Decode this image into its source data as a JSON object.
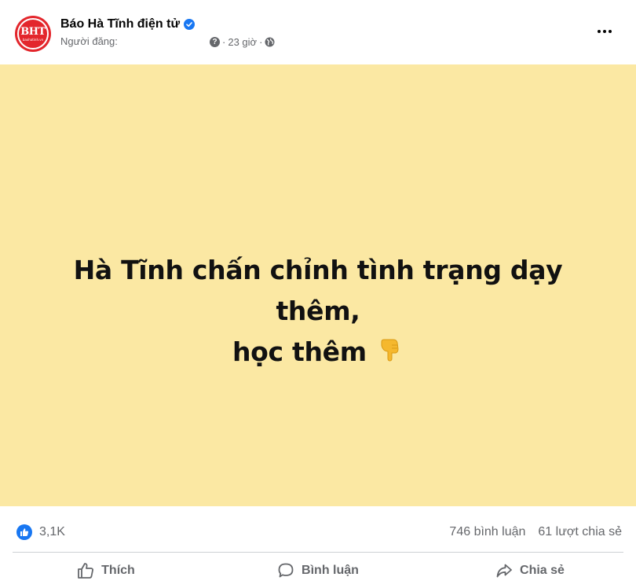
{
  "post": {
    "page_name": "Báo Hà Tĩnh điện tử",
    "avatar_text": "BHT",
    "avatar_subtext": "baohatinh.vn",
    "poster_label": "Người đăng:",
    "time": "23 giờ",
    "meta_separator": "·",
    "help_icon_glyph": "?",
    "icons": {
      "verified": "verified-badge-icon",
      "help": "question-icon",
      "privacy": "globe-icon",
      "more": "more-options-icon",
      "emoji": "backhand-index-pointing-down-icon"
    },
    "content_lines": [
      "Hà Tĩnh chấn chỉnh tình trạng dạy thêm,",
      "học thêm"
    ],
    "background_color": "#fbe8a3"
  },
  "stats": {
    "reaction_count": "3,1K",
    "comments": "746 bình luận",
    "shares": "61 lượt chia sẻ"
  },
  "actions": {
    "like_label": "Thích",
    "comment_label": "Bình luận",
    "share_label": "Chia sẻ"
  },
  "colors": {
    "brand_red": "#e3262c",
    "facebook_blue": "#1877f2",
    "secondary_text": "#65676b"
  }
}
